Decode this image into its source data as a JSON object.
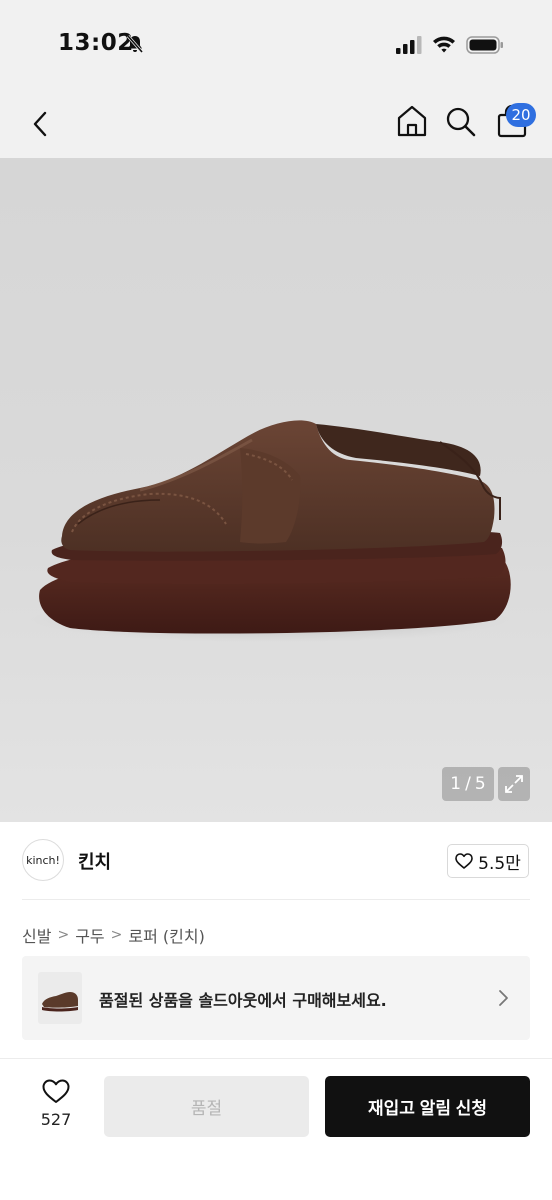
{
  "status_bar": {
    "time": "13:02",
    "icons": [
      "bell-slash-icon",
      "signal-icon",
      "wifi-icon",
      "battery-icon"
    ]
  },
  "nav": {
    "back_icon": "chevron-left-icon",
    "home_icon": "home-icon",
    "search_icon": "search-icon",
    "cart_icon": "bag-icon",
    "cart_count": "20"
  },
  "gallery": {
    "current": "1",
    "separator": "/",
    "total": "5",
    "expand_icon": "expand-icon"
  },
  "brand": {
    "logo_text": "kinch!",
    "name": "킨치",
    "likes": "5.5만"
  },
  "breadcrumb": {
    "items": [
      "신발",
      "구두",
      "로퍼 (킨치)"
    ],
    "separator": ">"
  },
  "soldout_banner": {
    "text": "품절된 상품을 솔드아웃에서 구매해보세요."
  },
  "bottom_bar": {
    "wish_count": "527",
    "soldout_label": "품절",
    "restock_label": "재입고 알림 신청"
  },
  "colors": {
    "accent_badge": "#2f6fe0",
    "primary_button": "#111111",
    "disabled_button": "#ebebeb",
    "shoe_suede": "#5a3a2a",
    "shoe_sole": "#4a231c"
  }
}
